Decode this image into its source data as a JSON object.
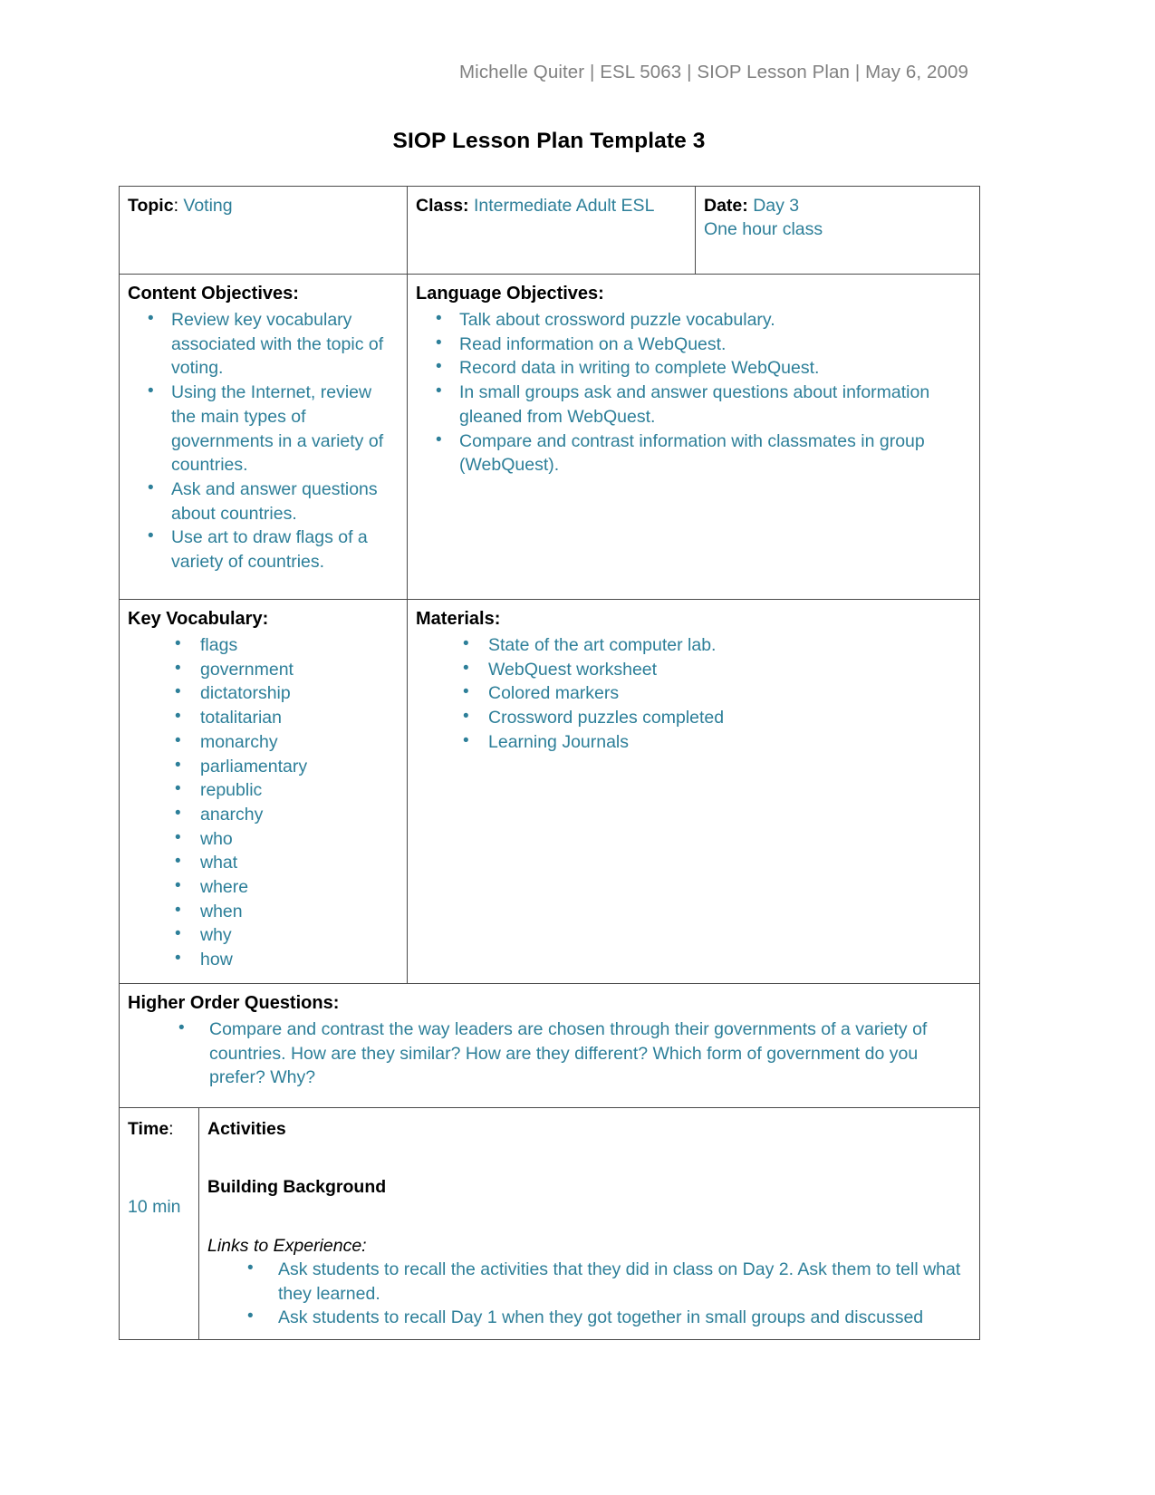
{
  "header": {
    "text": "Michelle Quiter | ESL 5063 | SIOP Lesson Plan | May 6, 2009"
  },
  "title": "SIOP Lesson Plan Template 3",
  "colors": {
    "body_teal": "#2d7f99",
    "label_black": "#000000",
    "header_gray": "#808080",
    "border": "#4a4a4a"
  },
  "table": {
    "row_info": {
      "topic_label": "Topic",
      "topic_sep": ": ",
      "topic_value": "Voting",
      "class_label": "Class:",
      "class_value": "Intermediate Adult ESL",
      "date_label": "Date:",
      "date_value": "Day 3",
      "date_value_2": "One hour class"
    },
    "row_objectives": {
      "content_heading": "Content Objectives:",
      "content_items": [
        "Review key vocabulary associated with the topic of voting.",
        "Using the Internet, review the main types of governments in a variety of countries.",
        "Ask and answer questions about countries.",
        "Use art to draw flags of a variety of countries."
      ],
      "language_heading": "Language Objectives:",
      "language_items": [
        "Talk about crossword puzzle vocabulary.",
        "Read information on a WebQuest.",
        "Record data in writing to complete WebQuest.",
        "In small groups ask and answer questions about information gleaned from WebQuest.",
        "Compare and contrast information with classmates in group (WebQuest)."
      ]
    },
    "row_vocab": {
      "vocab_heading": "Key Vocabulary:",
      "vocab_items": [
        "flags",
        "government",
        "dictatorship",
        "totalitarian",
        "monarchy",
        "parliamentary",
        "republic",
        "anarchy",
        "who",
        "what",
        "where",
        "when",
        "why",
        "how"
      ],
      "materials_heading": "Materials:",
      "materials_items": [
        "State of the art computer lab.",
        "WebQuest worksheet",
        "Colored markers",
        "Crossword puzzles completed",
        "Learning Journals"
      ]
    },
    "row_hoq": {
      "heading": "Higher Order Questions:",
      "items": [
        "Compare and contrast the way leaders are chosen through their governments of a variety of countries. How are they similar? How are they different? Which form of government do you prefer? Why?"
      ]
    },
    "row_activities": {
      "time_label": "Time",
      "time_label_sep": ":",
      "activities_label": "Activities",
      "section_heading": "Building Background",
      "time_value": "10 min",
      "subheading": "Links to Experience:",
      "items": [
        "Ask students to recall the activities that they did in class on Day 2. Ask them to tell what they learned.",
        "Ask students to recall Day 1 when they got together in small groups and discussed"
      ]
    }
  }
}
